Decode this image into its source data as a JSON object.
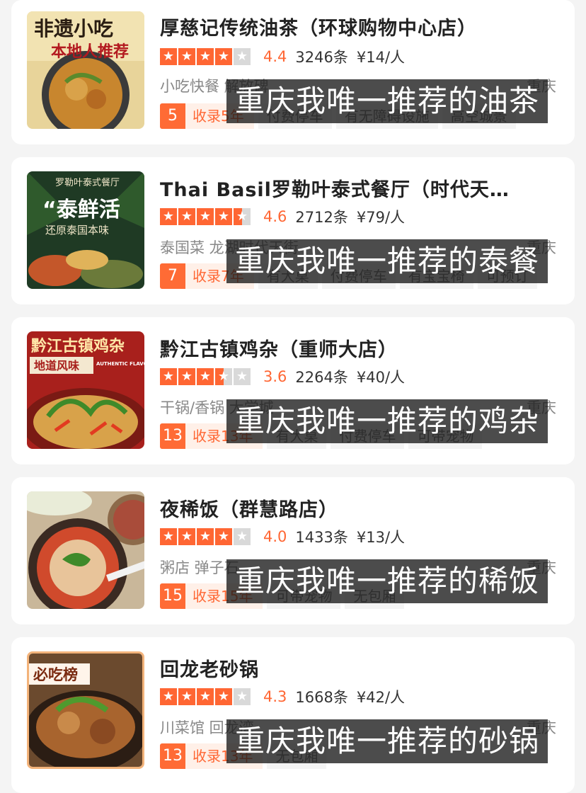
{
  "restaurants": [
    {
      "name": "厚慈记传统油茶（环球购物中心店）",
      "stars": 4,
      "half": false,
      "score": "4.4",
      "reviews": "3246条",
      "price": "¥14/人",
      "categories": "小吃快餐 解放碑",
      "city": "重庆",
      "rank": "5",
      "included": "收录5年",
      "tags": [
        "付费停车",
        "有无障碍设施",
        "高空城景"
      ],
      "overlay": "重庆我唯一推荐的油茶",
      "thumb_text": [
        "非遗小吃",
        "本地人推荐"
      ]
    },
    {
      "name": "Thai Basil罗勒叶泰式餐厅（时代天…",
      "stars": 4,
      "half": true,
      "score": "4.6",
      "reviews": "2712条",
      "price": "¥79/人",
      "categories": "泰国菜 龙湖时代天街",
      "city": "重庆",
      "rank": "7",
      "included": "收录7年",
      "tags": [
        "有大桌",
        "付费停车",
        "有宝宝椅",
        "可预订"
      ],
      "overlay": "重庆我唯一推荐的泰餐",
      "thumb_text": [
        "罗勒叶泰式餐厅",
        "“泰鲜活",
        "还原泰国本味"
      ]
    },
    {
      "name": "黔江古镇鸡杂（重师大店）",
      "stars": 3,
      "half": true,
      "score": "3.6",
      "reviews": "2264条",
      "price": "¥40/人",
      "categories": "干锅/香锅 大学城",
      "city": "重庆",
      "rank": "13",
      "included": "收录13年",
      "tags": [
        "有大桌",
        "付费停车",
        "可带宠物"
      ],
      "overlay": "重庆我唯一推荐的鸡杂",
      "thumb_text": [
        "黔江古镇鸡杂",
        "地道风味",
        "AUTHENTIC FLAVOR"
      ]
    },
    {
      "name": "夜稀饭（群慧路店）",
      "stars": 4,
      "half": false,
      "score": "4.0",
      "reviews": "1433条",
      "price": "¥13/人",
      "categories": "粥店 弹子石",
      "city": "重庆",
      "rank": "15",
      "included": "收录15年",
      "tags": [
        "可带宠物",
        "无包厢"
      ],
      "overlay": "重庆我唯一推荐的稀饭",
      "thumb_text": []
    },
    {
      "name": "回龙老砂锅",
      "stars": 4,
      "half": false,
      "score": "4.3",
      "reviews": "1668条",
      "price": "¥42/人",
      "categories": "川菜馆 回龙湾",
      "city": "重庆",
      "rank": "13",
      "included": "收录13年",
      "tags": [
        "无包厢"
      ],
      "overlay": "重庆我唯一推荐的砂锅",
      "thumb_text": [
        "必吃榜"
      ]
    }
  ],
  "colors": {
    "accent": "#ff6633",
    "background": "#f4f4f4",
    "overlay": "#191919"
  },
  "icons": [
    "star-icon"
  ]
}
